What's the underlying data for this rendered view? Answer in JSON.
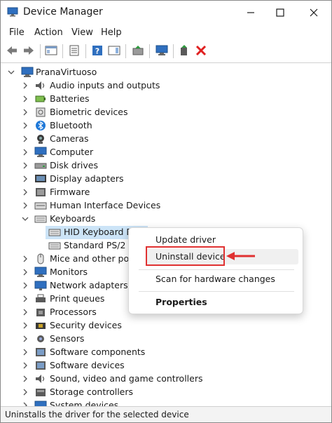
{
  "window": {
    "title": "Device Manager",
    "controls": {
      "minimize": "—",
      "maximize": "☐",
      "close": "✕"
    }
  },
  "menu": [
    "File",
    "Action",
    "View",
    "Help"
  ],
  "tree": {
    "root": "PranaVirtuoso",
    "items": [
      {
        "label": "Audio inputs and outputs",
        "icon": "speaker-icon"
      },
      {
        "label": "Batteries",
        "icon": "battery-icon"
      },
      {
        "label": "Biometric devices",
        "icon": "fingerprint-icon"
      },
      {
        "label": "Bluetooth",
        "icon": "bluetooth-icon"
      },
      {
        "label": "Cameras",
        "icon": "camera-icon"
      },
      {
        "label": "Computer",
        "icon": "monitor-icon"
      },
      {
        "label": "Disk drives",
        "icon": "disk-drive-icon"
      },
      {
        "label": "Display adapters",
        "icon": "display-adapter-icon"
      },
      {
        "label": "Firmware",
        "icon": "firmware-icon"
      },
      {
        "label": "Human Interface Devices",
        "icon": "hid-icon"
      },
      {
        "label": "Keyboards",
        "icon": "keyboard-icon",
        "expanded": true
      },
      {
        "label": "HID Keyboard De",
        "icon": "keyboard-icon",
        "child": true,
        "selected": true
      },
      {
        "label": "Standard PS/2 Ke",
        "icon": "keyboard-icon",
        "child": true
      },
      {
        "label": "Mice and other poin",
        "icon": "mouse-icon"
      },
      {
        "label": "Monitors",
        "icon": "monitor-icon"
      },
      {
        "label": "Network adapters",
        "icon": "network-icon"
      },
      {
        "label": "Print queues",
        "icon": "printer-icon"
      },
      {
        "label": "Processors",
        "icon": "processor-icon"
      },
      {
        "label": "Security devices",
        "icon": "security-icon"
      },
      {
        "label": "Sensors",
        "icon": "sensor-icon"
      },
      {
        "label": "Software components",
        "icon": "component-icon"
      },
      {
        "label": "Software devices",
        "icon": "component-icon"
      },
      {
        "label": "Sound, video and game controllers",
        "icon": "speaker-icon"
      },
      {
        "label": "Storage controllers",
        "icon": "storage-icon"
      },
      {
        "label": "System devices",
        "icon": "system-icon"
      }
    ]
  },
  "context_menu": {
    "update": "Update driver",
    "uninstall": "Uninstall device",
    "scan": "Scan for hardware changes",
    "properties": "Properties"
  },
  "status_text": "Uninstalls the driver for the selected device",
  "colors": {
    "annotation": "#e03131",
    "selection": "#cce4f7",
    "accent": "#0067c0"
  }
}
